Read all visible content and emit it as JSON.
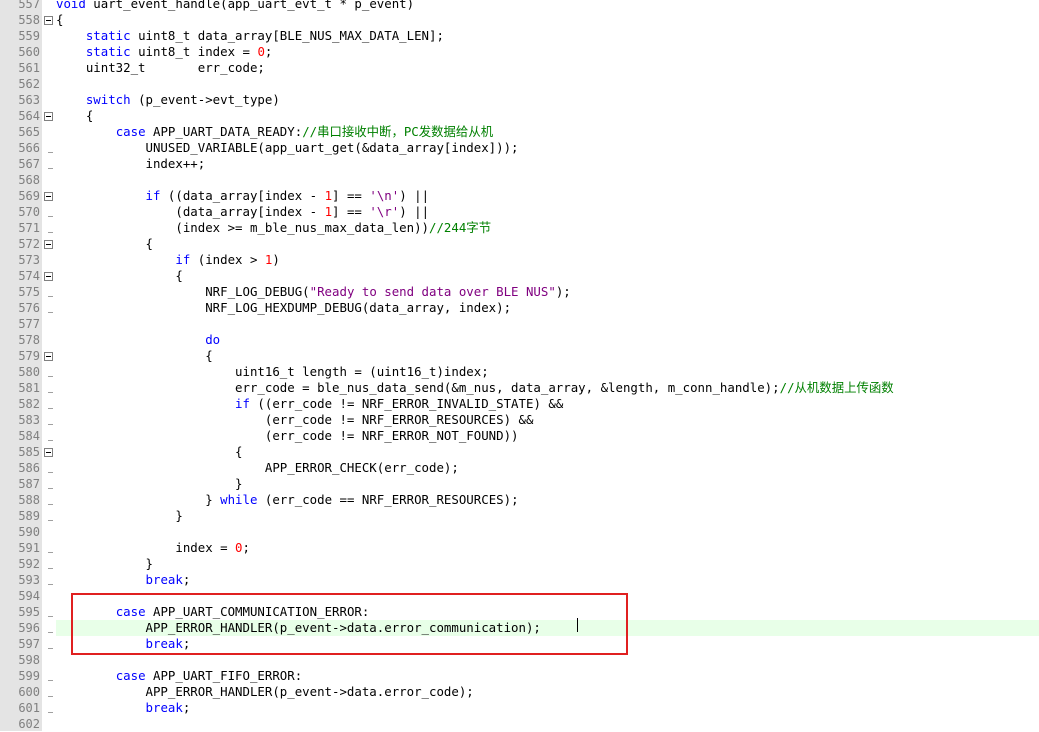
{
  "editor": {
    "lines": [
      {
        "n": "557",
        "html": "<span class='kw'>void</span> uart_event_handle(app_uart_evt_t * p_event)"
      },
      {
        "n": "558",
        "html": "{"
      },
      {
        "n": "559",
        "html": "    <span class='kw'>static</span> uint8_t data_array[BLE_NUS_MAX_DATA_LEN];"
      },
      {
        "n": "560",
        "html": "    <span class='kw'>static</span> uint8_t index = <span class='num'>0</span>;"
      },
      {
        "n": "561",
        "html": "    uint32_t       err_code;"
      },
      {
        "n": "562",
        "html": ""
      },
      {
        "n": "563",
        "html": "    <span class='kw'>switch</span> (p_event->evt_type)"
      },
      {
        "n": "564",
        "html": "    {"
      },
      {
        "n": "565",
        "html": "        <span class='kw'>case</span> APP_UART_DATA_READY:<span class='cm'>//串口接收中断，PC发数据给从机</span>"
      },
      {
        "n": "566",
        "html": "            UNUSED_VARIABLE(app_uart_get(&amp;data_array[index]));"
      },
      {
        "n": "567",
        "html": "            index++;"
      },
      {
        "n": "568",
        "html": ""
      },
      {
        "n": "569",
        "html": "            <span class='kw'>if</span> ((data_array[index - <span class='num'>1</span>] == <span class='str2'>'\\n'</span>) ||"
      },
      {
        "n": "570",
        "html": "                (data_array[index - <span class='num'>1</span>] == <span class='str2'>'\\r'</span>) ||"
      },
      {
        "n": "571",
        "html": "                (index >= m_ble_nus_max_data_len))<span class='cm'>//244字节</span>"
      },
      {
        "n": "572",
        "html": "            {"
      },
      {
        "n": "573",
        "html": "                <span class='kw'>if</span> (index > <span class='num'>1</span>)"
      },
      {
        "n": "574",
        "html": "                {"
      },
      {
        "n": "575",
        "html": "                    NRF_LOG_DEBUG(<span class='str2'>\"Ready to send data over BLE NUS\"</span>);"
      },
      {
        "n": "576",
        "html": "                    NRF_LOG_HEXDUMP_DEBUG(data_array, index);"
      },
      {
        "n": "577",
        "html": ""
      },
      {
        "n": "578",
        "html": "                    <span class='kw'>do</span>"
      },
      {
        "n": "579",
        "html": "                    {"
      },
      {
        "n": "580",
        "html": "                        uint16_t length = (uint16_t)index;"
      },
      {
        "n": "581",
        "html": "                        err_code = ble_nus_data_send(&amp;m_nus, data_array, &amp;length, m_conn_handle);<span class='cm'>//从机数据上传函数</span>"
      },
      {
        "n": "582",
        "html": "                        <span class='kw'>if</span> ((err_code != NRF_ERROR_INVALID_STATE) &amp;&amp;"
      },
      {
        "n": "583",
        "html": "                            (err_code != NRF_ERROR_RESOURCES) &amp;&amp;"
      },
      {
        "n": "584",
        "html": "                            (err_code != NRF_ERROR_NOT_FOUND))"
      },
      {
        "n": "585",
        "html": "                        {"
      },
      {
        "n": "586",
        "html": "                            APP_ERROR_CHECK(err_code);"
      },
      {
        "n": "587",
        "html": "                        }"
      },
      {
        "n": "588",
        "html": "                    } <span class='kw'>while</span> (err_code == NRF_ERROR_RESOURCES);"
      },
      {
        "n": "589",
        "html": "                }"
      },
      {
        "n": "590",
        "html": ""
      },
      {
        "n": "591",
        "html": "                index = <span class='num'>0</span>;"
      },
      {
        "n": "592",
        "html": "            }"
      },
      {
        "n": "593",
        "html": "            <span class='kw'>break</span>;"
      },
      {
        "n": "594",
        "html": ""
      },
      {
        "n": "595",
        "html": "        <span class='kw'>case</span> APP_UART_COMMUNICATION_ERROR:"
      },
      {
        "n": "596",
        "html": "            APP_ERROR_HANDLER(p_event->data.error_communication);",
        "hl": true
      },
      {
        "n": "597",
        "html": "            <span class='kw'>break</span>;"
      },
      {
        "n": "598",
        "html": ""
      },
      {
        "n": "599",
        "html": "        <span class='kw'>case</span> APP_UART_FIFO_ERROR:"
      },
      {
        "n": "600",
        "html": "            APP_ERROR_HANDLER(p_event->data.error_code);"
      },
      {
        "n": "601",
        "html": "            <span class='kw'>break</span>;"
      },
      {
        "n": "602",
        "html": ""
      }
    ],
    "fold_markers": [
      "558",
      "564",
      "569",
      "572",
      "574",
      "579",
      "585"
    ]
  }
}
